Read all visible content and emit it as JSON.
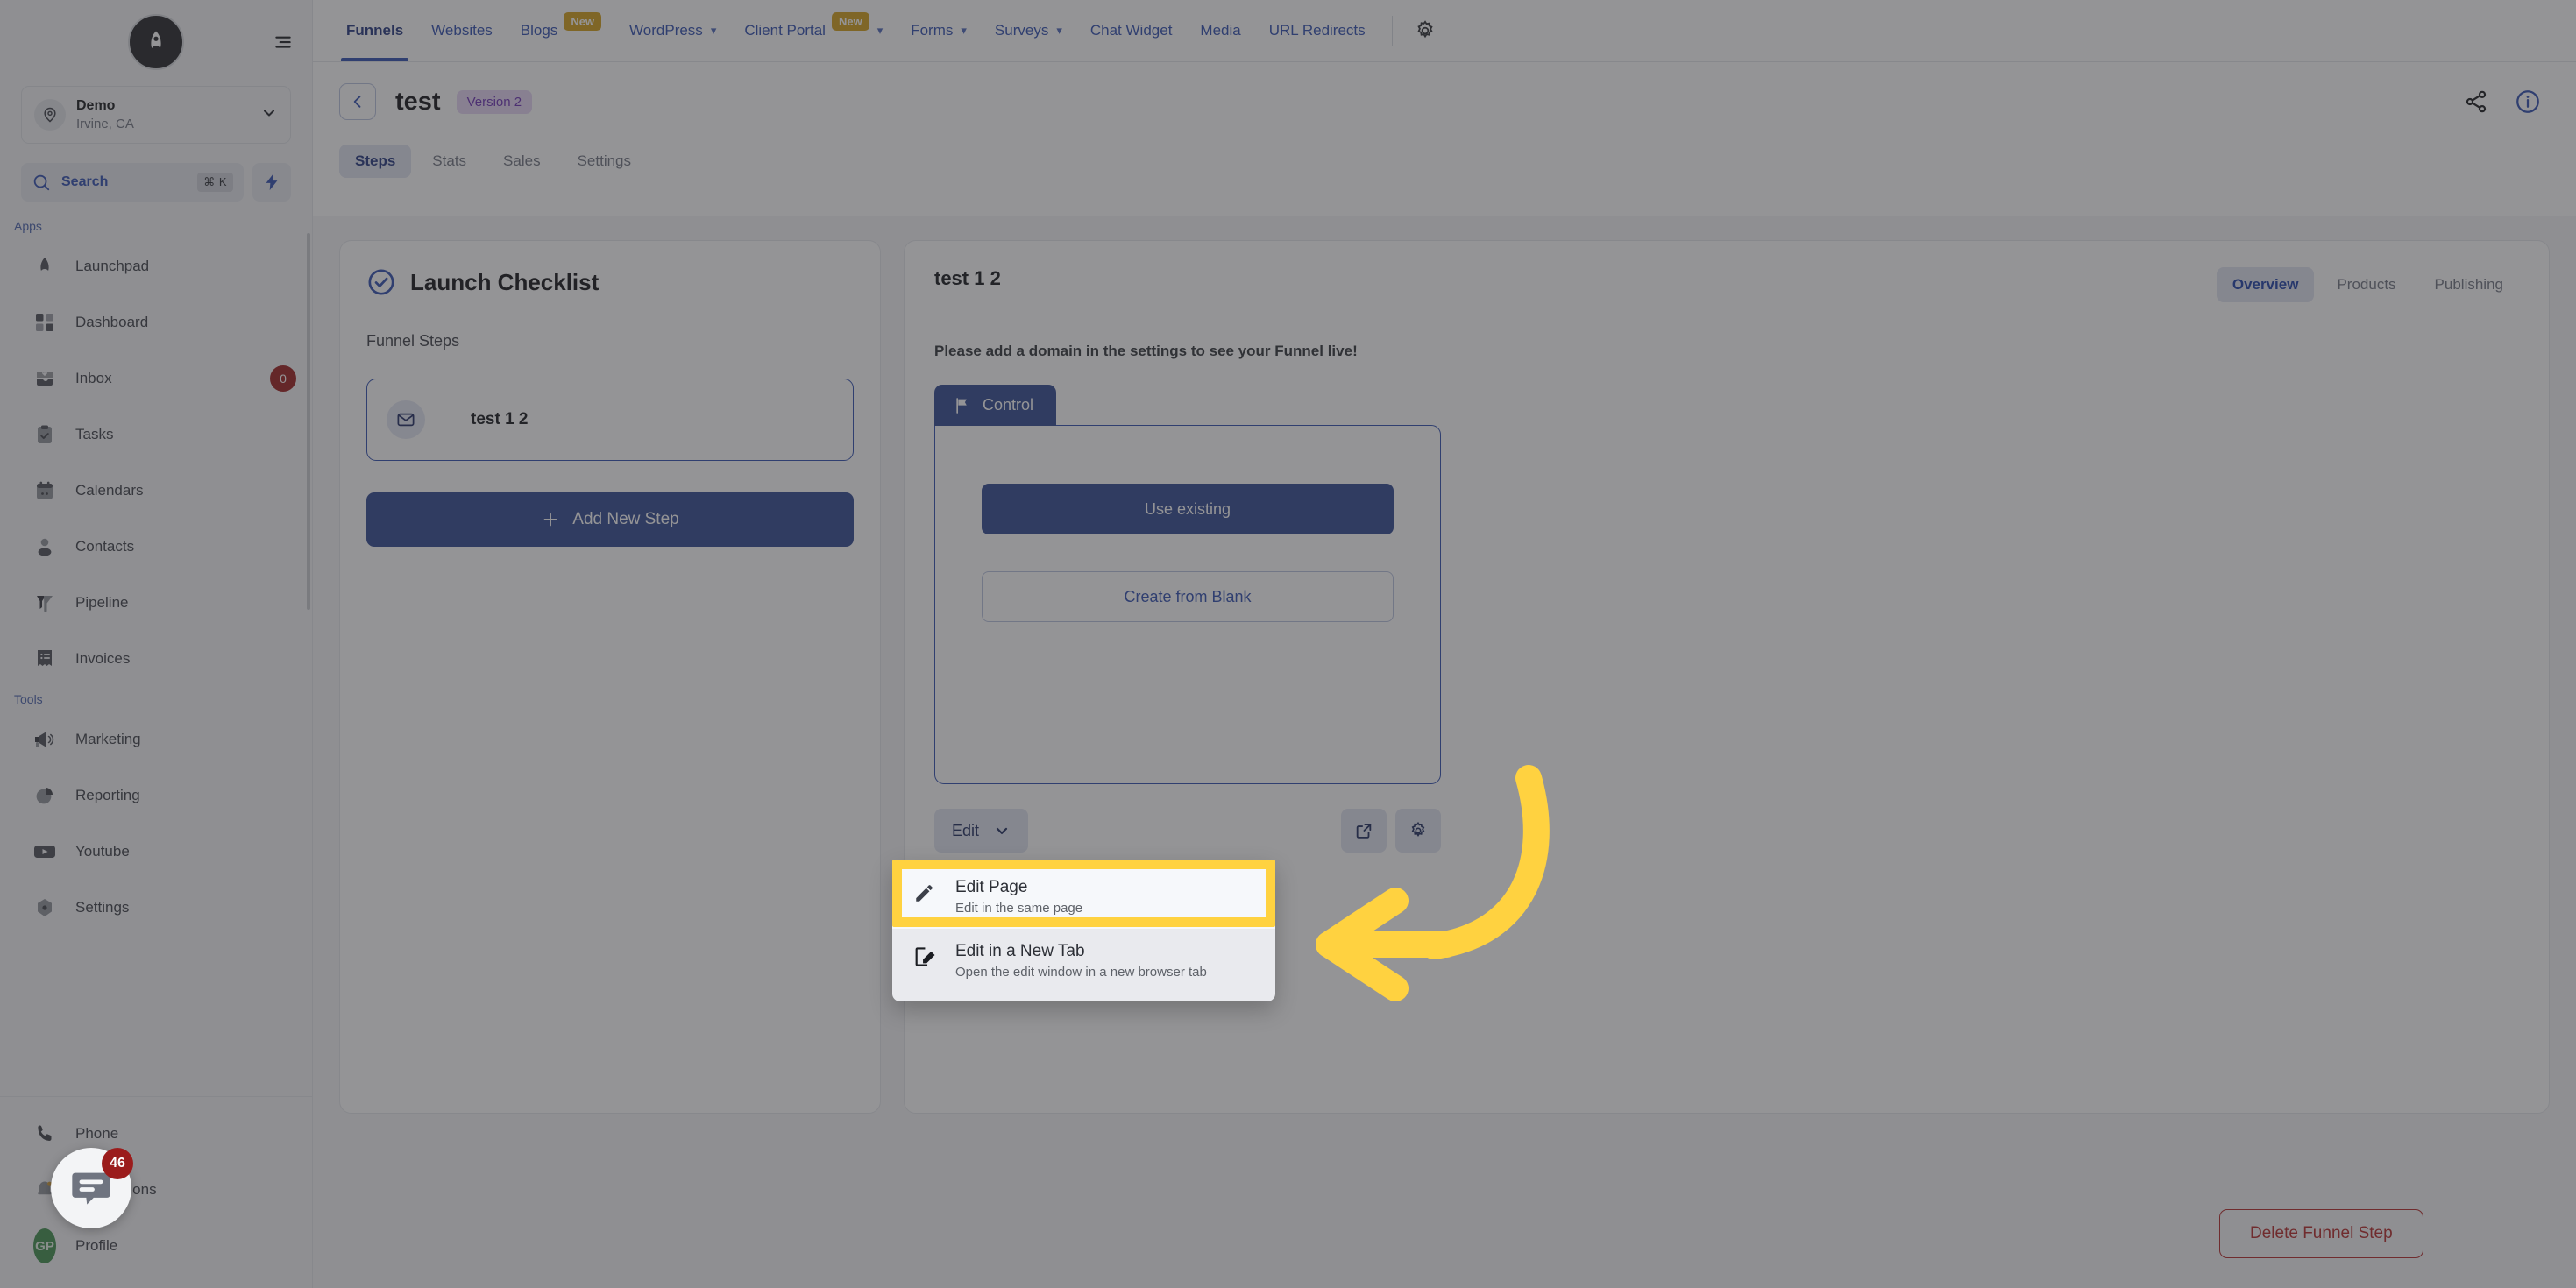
{
  "sidebar": {
    "logo_alt": "rocket-logo",
    "location": {
      "name": "Demo",
      "sub": "Irvine, CA"
    },
    "search": {
      "label": "Search",
      "shortcut": "⌘ K"
    },
    "groups": [
      {
        "label": "Apps",
        "items": [
          {
            "label": "Launchpad",
            "icon": "rocket-icon",
            "badge": null
          },
          {
            "label": "Dashboard",
            "icon": "grid-icon",
            "badge": null
          },
          {
            "label": "Inbox",
            "icon": "inbox-icon",
            "badge": "0"
          },
          {
            "label": "Tasks",
            "icon": "clipboard-icon",
            "badge": null
          },
          {
            "label": "Calendars",
            "icon": "calendar-icon",
            "badge": null
          },
          {
            "label": "Contacts",
            "icon": "user-icon",
            "badge": null
          },
          {
            "label": "Pipeline",
            "icon": "funnel-icon",
            "badge": null
          },
          {
            "label": "Invoices",
            "icon": "invoice-icon",
            "badge": null
          }
        ]
      },
      {
        "label": "Tools",
        "items": [
          {
            "label": "Marketing",
            "icon": "megaphone-icon",
            "badge": null
          },
          {
            "label": "Reporting",
            "icon": "pie-chart-icon",
            "badge": null
          },
          {
            "label": "Youtube",
            "icon": "youtube-icon",
            "badge": null
          },
          {
            "label": "Settings",
            "icon": "settings-icon",
            "badge": null
          }
        ]
      }
    ],
    "footer": [
      {
        "label": "Phone",
        "icon": "phone-icon"
      },
      {
        "label": "Notifications",
        "icon": "bell-icon"
      },
      {
        "label": "Profile",
        "icon": "avatar-icon",
        "initials": "GP"
      }
    ]
  },
  "topnav": {
    "items": [
      {
        "label": "Funnels",
        "active": true,
        "badge": null,
        "caret": false
      },
      {
        "label": "Websites",
        "active": false,
        "badge": null,
        "caret": false
      },
      {
        "label": "Blogs",
        "active": false,
        "badge": "New",
        "caret": false
      },
      {
        "label": "WordPress",
        "active": false,
        "badge": null,
        "caret": true
      },
      {
        "label": "Client Portal",
        "active": false,
        "badge": "New",
        "caret": true
      },
      {
        "label": "Forms",
        "active": false,
        "badge": null,
        "caret": true
      },
      {
        "label": "Surveys",
        "active": false,
        "badge": null,
        "caret": true
      },
      {
        "label": "Chat Widget",
        "active": false,
        "badge": null,
        "caret": false
      },
      {
        "label": "Media",
        "active": false,
        "badge": null,
        "caret": false
      },
      {
        "label": "URL Redirects",
        "active": false,
        "badge": null,
        "caret": false
      }
    ],
    "gear_icon": "gear-icon"
  },
  "page_header": {
    "back_icon": "chevron-left-icon",
    "title": "test",
    "version_badge": "Version 2",
    "share_icon": "share-icon",
    "info_icon": "info-icon",
    "tabs": [
      {
        "label": "Steps",
        "active": true
      },
      {
        "label": "Stats",
        "active": false
      },
      {
        "label": "Sales",
        "active": false
      },
      {
        "label": "Settings",
        "active": false
      }
    ]
  },
  "checklist": {
    "title": "Launch Checklist",
    "check_icon": "check-circle-icon",
    "section_label": "Funnel Steps",
    "steps": [
      {
        "label": "test 1 2",
        "icon": "envelope-icon"
      }
    ],
    "add_step_label": "Add New Step",
    "add_step_icon": "plus-icon"
  },
  "detail": {
    "title": "test 1 2",
    "tabs": [
      {
        "label": "Overview",
        "active": true
      },
      {
        "label": "Products",
        "active": false
      },
      {
        "label": "Publishing",
        "active": false
      }
    ],
    "notice": "Please add a domain in the settings to see your Funnel live!",
    "control": {
      "tab_label": "Control",
      "tab_icon": "flag-icon",
      "use_existing_label": "Use existing",
      "create_blank_label": "Create from Blank"
    },
    "toolbar": {
      "edit_label": "Edit",
      "edit_caret_icon": "chevron-down-icon",
      "open_external_icon": "external-link-icon",
      "settings_icon": "gear-icon"
    },
    "delete_label": "Delete Funnel Step"
  },
  "edit_menu": {
    "items": [
      {
        "title": "Edit Page",
        "desc": "Edit in the same page",
        "icon": "pencil-icon",
        "highlighted": true
      },
      {
        "title": "Edit in a New Tab",
        "desc": "Open the edit window in a new browser tab",
        "icon": "pencil-square-icon",
        "highlighted": false
      }
    ]
  },
  "annotation": {
    "highlight_color": "#ffd240",
    "arrow_icon": "curved-arrow-left-icon"
  },
  "chat_widget": {
    "icon": "chat-bubble-icon",
    "badge": "46"
  }
}
